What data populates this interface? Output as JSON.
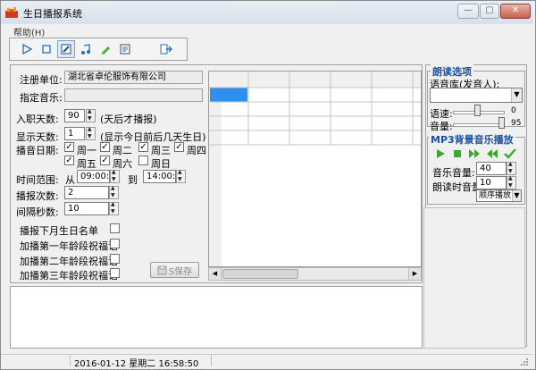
{
  "window": {
    "title": "生日播报系统"
  },
  "menu": {
    "help": "帮助(H)"
  },
  "form": {
    "register_unit_label": "注册单位:",
    "register_unit_value": "湖北省卓伦服饰有限公司",
    "music_label": "指定音乐:",
    "music_value": "",
    "entry_days_label": "入职天数:",
    "entry_days_value": "90",
    "entry_days_hint": "(天后才播报)",
    "display_days_label": "显示天数:",
    "display_days_value": "1",
    "display_days_hint": "(显示今日前后几天生日)",
    "broadcast_date_label": "播音日期:",
    "weekdays": [
      {
        "label": "周一",
        "checked": true
      },
      {
        "label": "周二",
        "checked": true
      },
      {
        "label": "周三",
        "checked": true
      },
      {
        "label": "周四",
        "checked": true
      },
      {
        "label": "周五",
        "checked": true
      },
      {
        "label": "周六",
        "checked": true
      },
      {
        "label": "周日",
        "checked": false
      }
    ],
    "time_range_label": "时间范围:",
    "time_from_label": "从",
    "time_from_value": "09:00:00",
    "time_to_label": "到",
    "time_to_value": "14:00:00",
    "broadcast_count_label": "播报次数:",
    "broadcast_count_value": "2",
    "interval_label": "间隔秒数:",
    "interval_value": "10",
    "options": [
      {
        "label": "播报下月生日名单",
        "checked": false
      },
      {
        "label": "加播第一年龄段祝福语",
        "checked": false
      },
      {
        "label": "加播第二年龄段祝福语",
        "checked": false
      },
      {
        "label": "加播第三年龄段祝福语",
        "checked": false
      }
    ],
    "save_label": "S保存"
  },
  "reading": {
    "title": "朗读选项",
    "voice_label": "语音库(发音人):",
    "voice_value": "",
    "speed_label": "语速:",
    "speed_value": "0",
    "volume_label": "音量:",
    "volume_value": "95"
  },
  "mp3": {
    "title": "MP3背景音乐播放",
    "music_volume_label": "音乐音量:",
    "music_volume_value": "40",
    "reading_volume_label": "朗读时音量:",
    "reading_volume_value": "10",
    "play_mode_value": "顺序播放"
  },
  "status": {
    "datetime": "2016-01-12 星期二 16:58:50"
  },
  "colors": {
    "accent_blue": "#3b8ce8",
    "play_green": "#3aa82a",
    "selected_cell": "#2f8fef"
  }
}
